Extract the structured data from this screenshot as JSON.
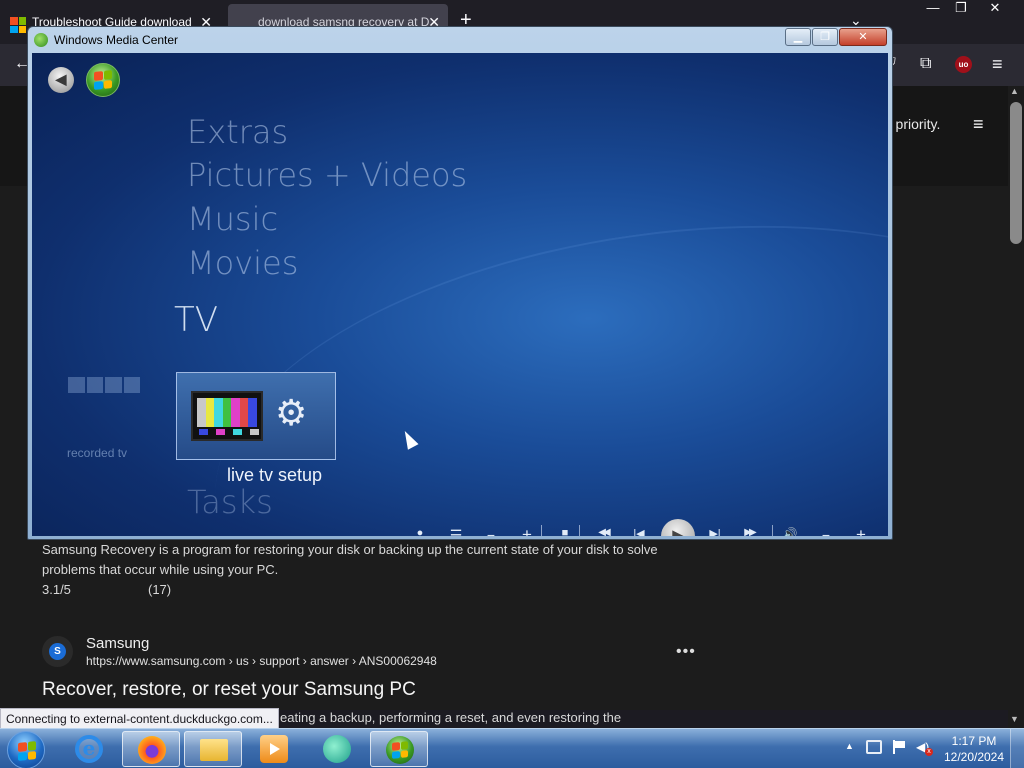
{
  "browser": {
    "tabs": [
      {
        "title": "Troubleshoot Guide download",
        "close": "✕"
      },
      {
        "title": "download samsng recovery at D",
        "close": "✕"
      }
    ],
    "new_tab": "+",
    "tab_list": "⌄",
    "window_controls": {
      "minimize": "—",
      "restore": "❐",
      "close": "✕"
    },
    "toolbar": {
      "back": "←",
      "reader": "⛉",
      "extensions": "⧉",
      "ublock": "uo",
      "menu": "≡"
    },
    "header_text": "r priority.",
    "header_menu": "≡",
    "scroll_up": "▲",
    "scroll_down": "▼"
  },
  "results": {
    "snippet1": "Samsung Recovery is a program for restoring your disk or backing up the current state of your disk to solve problems that occur while using your PC.",
    "rating": "3.1/5",
    "rating_count": "(17)",
    "site_initial": "S",
    "site_name": "Samsung",
    "site_url": "https://www.samsung.com › us › support › answer › ANS00062948",
    "more": "•••",
    "title": "Recover, restore, or reset your Samsung PC",
    "snippet2": "eating a backup, performing a reset, and even restoring the"
  },
  "status_bar": "Connecting to external-content.duckduckgo.com...",
  "wmc": {
    "title": "Windows Media Center",
    "controls": {
      "minimize": "▁",
      "restore": "❐",
      "close": "✕"
    },
    "back": "◀",
    "menu": [
      "Extras",
      "Pictures + Videos",
      "Music",
      "Movies"
    ],
    "current": "TV",
    "next": "Tasks",
    "side_tile_label": "recorded tv",
    "main_tile_label": "live tv setup",
    "gear": "⚙",
    "transport": {
      "record": "●",
      "guide": "☰",
      "ch_down": "−",
      "ch_up": "+",
      "stop": "■",
      "rewind": "◀◀",
      "prev": "|◀",
      "play": "▶",
      "next": "▶|",
      "ffwd": "▶▶",
      "mute": "🔊",
      "vol_down": "−",
      "vol_up": "+"
    },
    "tv_bar_colors": [
      "#c8c8c8",
      "#e8e840",
      "#40d8e0",
      "#40c040",
      "#e040c8",
      "#e04848",
      "#3848e0"
    ],
    "brand_colors": {
      "flag_red": "#f25022",
      "flag_green": "#7fba00",
      "flag_blue": "#00a4ef",
      "flag_yellow": "#ffb900"
    }
  },
  "taskbar": {
    "apps": [
      "Internet Explorer",
      "Firefox",
      "Windows Explorer",
      "Media Player",
      "Messenger",
      "Windows Media Center"
    ],
    "ie_letter": "e",
    "tray_arrow": "▲",
    "volume": "◀)",
    "volume_mute": "x",
    "time": "1:17 PM",
    "date": "12/20/2024"
  }
}
